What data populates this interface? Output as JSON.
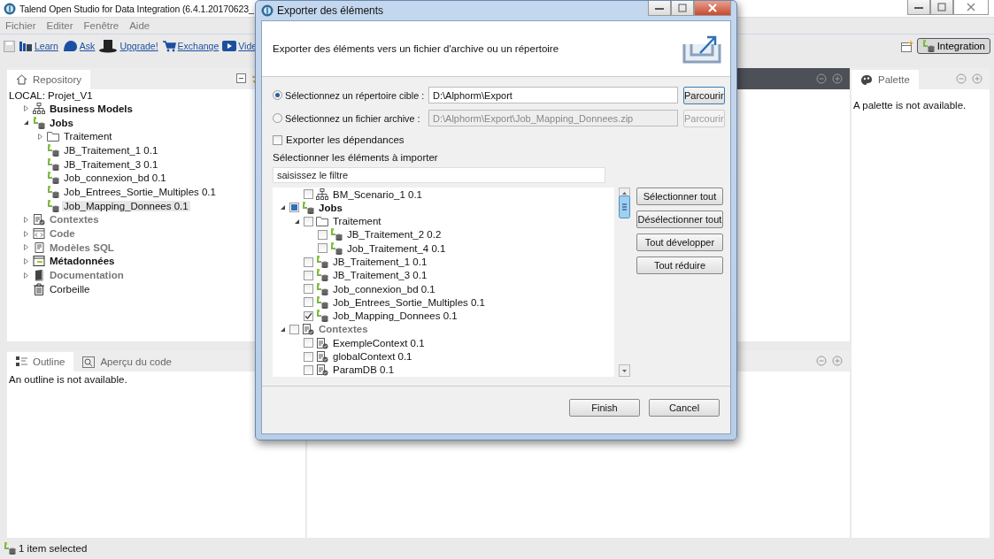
{
  "window": {
    "title": "Talend Open Studio for Data Integration (6.4.1.20170623_"
  },
  "menu": [
    "Fichier",
    "Editer",
    "Fenêtre",
    "Aide"
  ],
  "toolbar": [
    {
      "kind": "learn",
      "label": "Learn"
    },
    {
      "kind": "ask",
      "label": "Ask"
    },
    {
      "kind": "upgrade",
      "label": "Upgrade!"
    },
    {
      "kind": "exchange",
      "label": "Exchange"
    },
    {
      "kind": "video",
      "label": "Vide"
    }
  ],
  "perspective": {
    "label": "Integration",
    "selected": true
  },
  "repository": {
    "tab": "Repository",
    "project": "LOCAL: Projet_V1",
    "items": [
      {
        "kind": "model",
        "label": "Business Models",
        "bold": true,
        "muted": false,
        "expanded": false,
        "selected": false
      },
      {
        "kind": "job",
        "label": "Jobs",
        "bold": true,
        "muted": false,
        "expanded": true,
        "selected": false,
        "children": [
          {
            "kind": "folder",
            "label": "Traitement",
            "expanded": false,
            "selected": false
          },
          {
            "kind": "job",
            "label": "JB_Traitement_1 0.1",
            "selected": false
          },
          {
            "kind": "job",
            "label": "JB_Traitement_3 0.1",
            "selected": false
          },
          {
            "kind": "job",
            "label": "Job_connexion_bd 0.1",
            "selected": false
          },
          {
            "kind": "job",
            "label": "Job_Entrees_Sortie_Multiples 0.1",
            "selected": false
          },
          {
            "kind": "job",
            "label": "Job_Mapping_Donnees 0.1",
            "selected": true
          }
        ]
      },
      {
        "kind": "context",
        "label": "Contextes",
        "bold": true,
        "muted": true,
        "expanded": false,
        "selected": false
      },
      {
        "kind": "code",
        "label": "Code",
        "bold": true,
        "muted": true,
        "expanded": false,
        "selected": false
      },
      {
        "kind": "sql",
        "label": "Modèles SQL",
        "bold": true,
        "muted": true,
        "expanded": false,
        "selected": false
      },
      {
        "kind": "metadata",
        "label": "Métadonnées",
        "bold": true,
        "muted": false,
        "expanded": false,
        "selected": false
      },
      {
        "kind": "doc",
        "label": "Documentation",
        "bold": true,
        "muted": true,
        "expanded": false,
        "selected": false
      },
      {
        "kind": "trash",
        "label": "Corbeille",
        "bold": false,
        "muted": false,
        "selected": false
      }
    ]
  },
  "outline": {
    "tabs": [
      {
        "kind": "outline",
        "label": "Outline",
        "selected": true
      },
      {
        "kind": "code",
        "label": "Aperçu du code",
        "selected": false
      }
    ],
    "message": "An outline is not available."
  },
  "palette": {
    "tab": "Palette",
    "message": "A palette is not available."
  },
  "status_bar": "1 item selected",
  "dialog": {
    "title": "Exporter des éléments",
    "heading": "Exporter des éléments vers un fichier d'archive ou un répertoire",
    "targets": [
      {
        "label": "Sélectionnez un répertoire cible :",
        "value": "D:\\Alphorm\\Export",
        "button": "Parcourir",
        "selected": true,
        "disabled": false
      },
      {
        "label": "Sélectionnez un fichier archive :",
        "value": "D:\\Alphorm\\Export\\Job_Mapping_Donnees.zip",
        "button": "Parcourir",
        "selected": false,
        "disabled": true
      }
    ],
    "dependencies": {
      "label": "Exporter les dépendances",
      "checked": false
    },
    "filter_label": "Sélectionner les éléments à importer",
    "filter": {
      "placeholder": "saisissez le filtre"
    },
    "tree_above": [
      {
        "kind": "model",
        "label": "BM_Scenario_1 0.1",
        "checked": false
      }
    ],
    "tree": [
      {
        "kind": "job",
        "label": "Jobs",
        "bold": true,
        "muted": false,
        "checked": false,
        "partial": true,
        "expanded": true,
        "children": [
          {
            "kind": "folder",
            "label": "Traitement",
            "checked": false,
            "expanded": true,
            "children": [
              {
                "kind": "job",
                "label": "JB_Traitement_2 0.2",
                "checked": false
              },
              {
                "kind": "job",
                "label": "Job_Traitement_4 0.1",
                "checked": false
              }
            ]
          },
          {
            "kind": "job",
            "label": "JB_Traitement_1 0.1",
            "checked": false
          },
          {
            "kind": "job",
            "label": "JB_Traitement_3 0.1",
            "checked": false
          },
          {
            "kind": "job",
            "label": "Job_connexion_bd 0.1",
            "checked": false
          },
          {
            "kind": "job",
            "label": "Job_Entrees_Sortie_Multiples 0.1",
            "checked": false
          },
          {
            "kind": "job",
            "label": "Job_Mapping_Donnees 0.1",
            "checked": true
          }
        ]
      },
      {
        "kind": "context",
        "label": "Contextes",
        "bold": true,
        "muted": true,
        "checked": false,
        "partial": false,
        "expanded": true,
        "children": [
          {
            "kind": "context",
            "label": "ExempleContext 0.1",
            "checked": false
          },
          {
            "kind": "context",
            "label": "globalContext 0.1",
            "checked": false
          },
          {
            "kind": "context",
            "label": "ParamDB 0.1",
            "checked": false
          }
        ]
      }
    ],
    "side_buttons": [
      "Sélectionner tout",
      "Désélectionner tout",
      "Tout développer",
      "Tout réduire"
    ],
    "buttons": [
      "Finish",
      "Cancel"
    ]
  }
}
